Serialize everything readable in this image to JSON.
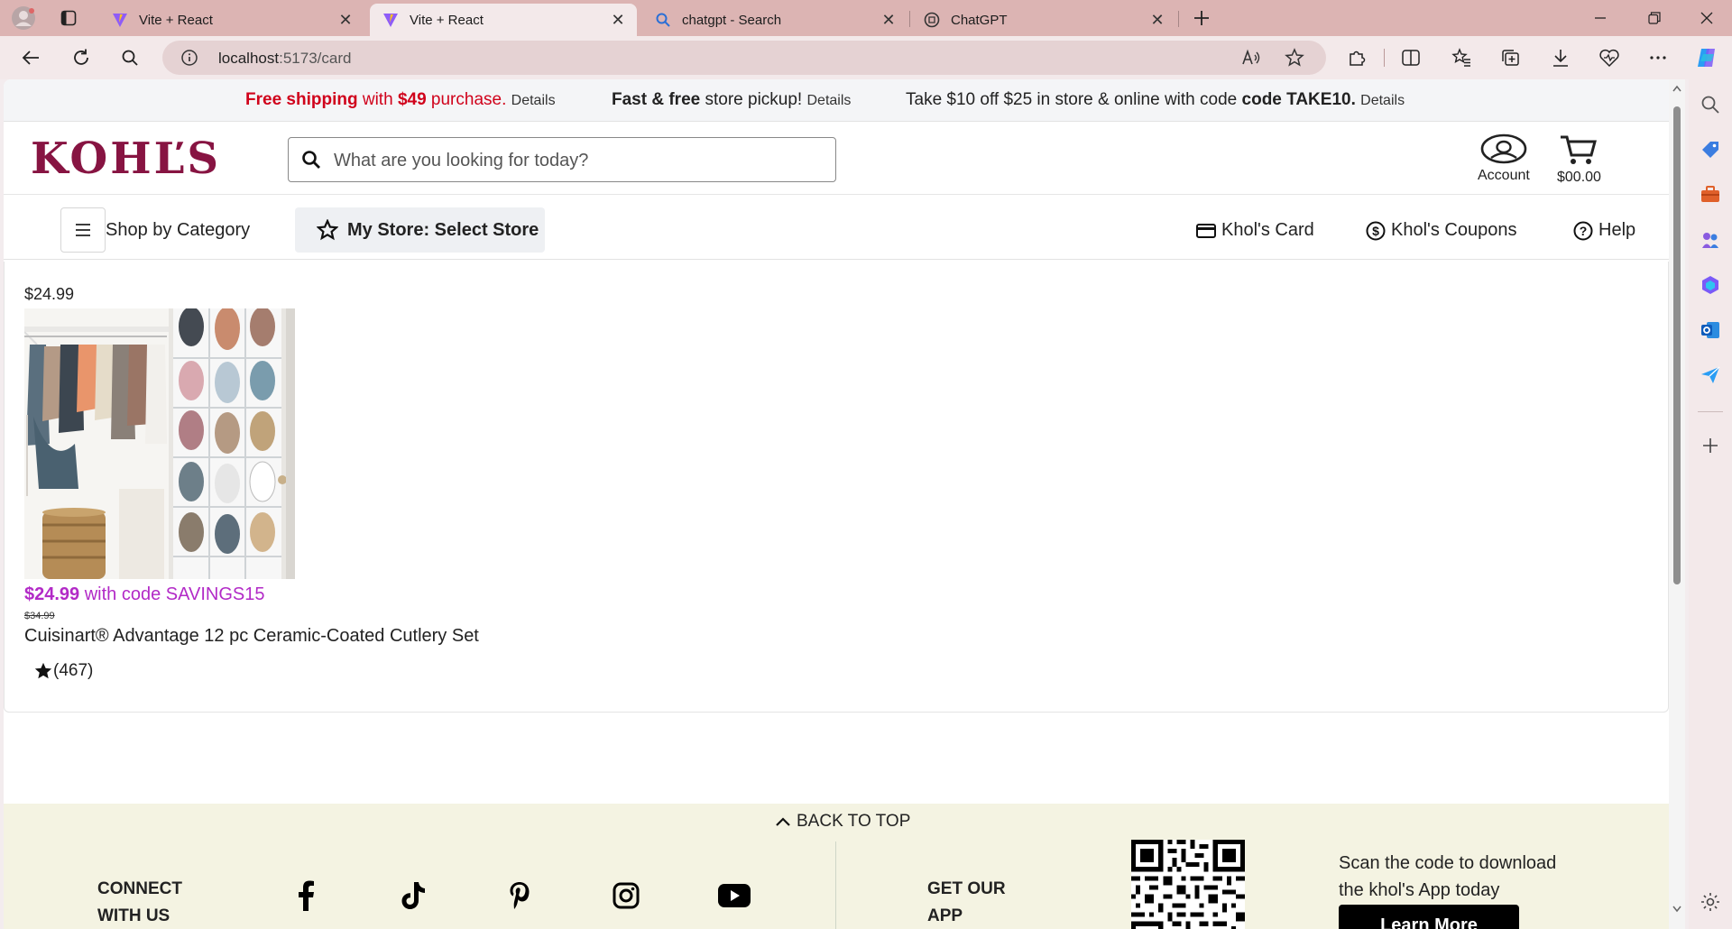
{
  "browser": {
    "tabs": [
      {
        "title": "Vite + React",
        "active": false
      },
      {
        "title": "Vite + React",
        "active": true
      },
      {
        "title": "chatgpt - Search",
        "active": false
      },
      {
        "title": "ChatGPT",
        "active": false
      }
    ],
    "url_host": "localhost",
    "url_rest": ":5173/card"
  },
  "promo": {
    "free_shipping": "Free shipping",
    "with": "with",
    "amount": "$49",
    "purchase": "purchase.",
    "details1": "Details",
    "fast_free": "Fast & free",
    "pickup": "store pickup!",
    "details2": "Details",
    "take_offer": "Take $10 off $25 in store & online with code",
    "code": "code TAKE10.",
    "details3": "Details"
  },
  "header": {
    "logo": "KOHĽS",
    "search_placeholder": "What are you looking for today?",
    "account_label": "Account",
    "cart_total": "$00.00"
  },
  "nav": {
    "shop_by_category": "Shop by Category",
    "my_store": "My Store: Select Store",
    "card": "Khol's Card",
    "coupons": "Khol's Coupons",
    "help": "Help"
  },
  "product": {
    "top_price": "$24.99",
    "sale_price": "$24.99",
    "sale_code_text": "with code SAVINGS15",
    "original_price": "$34.99",
    "title": "Cuisinart® Advantage 12 pc Ceramic-Coated Cutlery Set",
    "rating_count": "(467)"
  },
  "footer": {
    "back_to_top": "BACK TO TOP",
    "connect": "CONNECT WITH US",
    "get_app": "GET OUR APP",
    "scan_text": "Scan the code to download the khol's App today",
    "learn_more": "Learn More"
  },
  "colors": {
    "brand": "#871442",
    "promo_red": "#d0021b",
    "sale_purple": "#b22ac7",
    "tabbar": "#dcb4b3",
    "footer_bg": "#f4f3e2"
  }
}
